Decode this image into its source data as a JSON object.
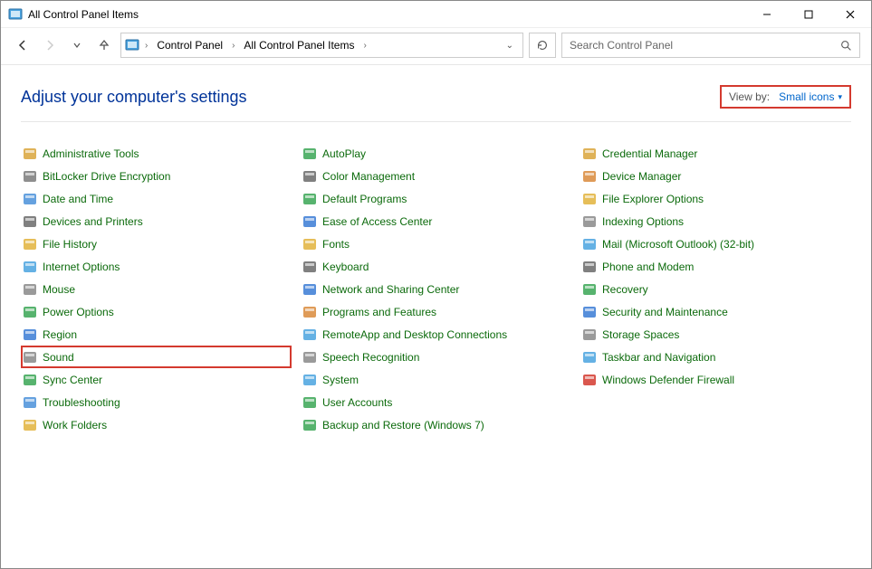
{
  "window": {
    "title": "All Control Panel Items"
  },
  "breadcrumbs": {
    "items": [
      "Control Panel",
      "All Control Panel Items"
    ]
  },
  "search": {
    "placeholder": "Search Control Panel"
  },
  "header": {
    "title": "Adjust your computer's settings",
    "viewby_label": "View by:",
    "viewby_value": "Small icons"
  },
  "items": {
    "col1": [
      {
        "label": "Administrative Tools",
        "icon": "admin-tools-icon"
      },
      {
        "label": "BitLocker Drive Encryption",
        "icon": "bitlocker-icon"
      },
      {
        "label": "Date and Time",
        "icon": "clock-icon"
      },
      {
        "label": "Devices and Printers",
        "icon": "printer-icon"
      },
      {
        "label": "File History",
        "icon": "file-history-icon"
      },
      {
        "label": "Internet Options",
        "icon": "internet-options-icon"
      },
      {
        "label": "Mouse",
        "icon": "mouse-icon"
      },
      {
        "label": "Power Options",
        "icon": "power-icon"
      },
      {
        "label": "Region",
        "icon": "region-icon"
      },
      {
        "label": "Sound",
        "icon": "sound-icon",
        "highlighted": true
      },
      {
        "label": "Sync Center",
        "icon": "sync-icon"
      },
      {
        "label": "Troubleshooting",
        "icon": "troubleshoot-icon"
      },
      {
        "label": "Work Folders",
        "icon": "work-folders-icon"
      }
    ],
    "col2": [
      {
        "label": "AutoPlay",
        "icon": "autoplay-icon"
      },
      {
        "label": "Color Management",
        "icon": "color-mgmt-icon"
      },
      {
        "label": "Default Programs",
        "icon": "default-programs-icon"
      },
      {
        "label": "Ease of Access Center",
        "icon": "ease-access-icon"
      },
      {
        "label": "Fonts",
        "icon": "fonts-icon"
      },
      {
        "label": "Keyboard",
        "icon": "keyboard-icon"
      },
      {
        "label": "Network and Sharing Center",
        "icon": "network-icon"
      },
      {
        "label": "Programs and Features",
        "icon": "programs-icon"
      },
      {
        "label": "RemoteApp and Desktop Connections",
        "icon": "remoteapp-icon"
      },
      {
        "label": "Speech Recognition",
        "icon": "speech-icon"
      },
      {
        "label": "System",
        "icon": "system-icon"
      },
      {
        "label": "User Accounts",
        "icon": "user-accounts-icon"
      }
    ],
    "col3": [
      {
        "label": "Backup and Restore (Windows 7)",
        "icon": "backup-icon"
      },
      {
        "label": "Credential Manager",
        "icon": "credential-icon"
      },
      {
        "label": "Device Manager",
        "icon": "device-manager-icon"
      },
      {
        "label": "File Explorer Options",
        "icon": "file-explorer-icon"
      },
      {
        "label": "Indexing Options",
        "icon": "indexing-icon"
      },
      {
        "label": "Mail (Microsoft Outlook) (32-bit)",
        "icon": "mail-icon"
      },
      {
        "label": "Phone and Modem",
        "icon": "phone-icon"
      },
      {
        "label": "Recovery",
        "icon": "recovery-icon"
      },
      {
        "label": "Security and Maintenance",
        "icon": "security-icon"
      },
      {
        "label": "Storage Spaces",
        "icon": "storage-icon"
      },
      {
        "label": "Taskbar and Navigation",
        "icon": "taskbar-icon"
      },
      {
        "label": "Windows Defender Firewall",
        "icon": "firewall-icon"
      }
    ]
  }
}
